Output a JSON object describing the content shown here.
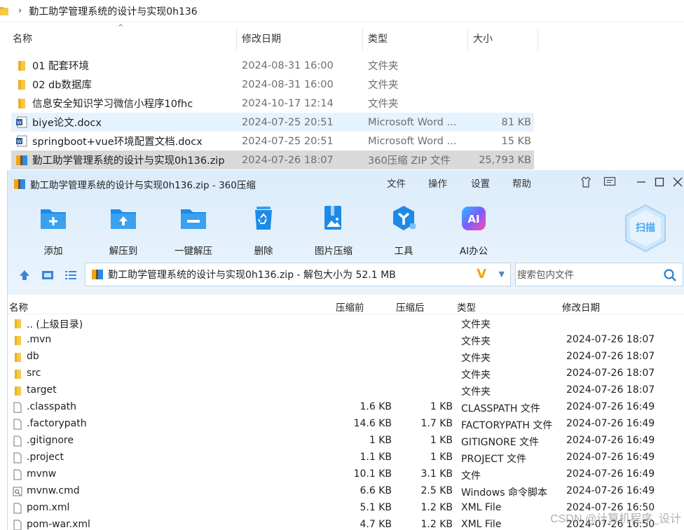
{
  "explorer": {
    "breadcrumb": "勤工助学管理系统的设计与实现0h136",
    "headers": {
      "name": "名称",
      "date": "修改日期",
      "type": "类型",
      "size": "大小"
    },
    "rows": [
      {
        "name": "01 配套环境",
        "date": "2024-08-31 16:00",
        "type": "文件夹",
        "size": "",
        "icon": "folder-icon"
      },
      {
        "name": "02 db数据库",
        "date": "2024-08-31 16:00",
        "type": "文件夹",
        "size": "",
        "icon": "folder-icon"
      },
      {
        "name": "信息安全知识学习微信小程序10fhc",
        "date": "2024-10-17 12:14",
        "type": "文件夹",
        "size": "",
        "icon": "folder-icon"
      },
      {
        "name": "biye论文.docx",
        "date": "2024-07-25 20:51",
        "type": "Microsoft Word ...",
        "size": "81 KB",
        "icon": "word-doc-icon"
      },
      {
        "name": "springboot+vue环境配置文档.docx",
        "date": "2024-07-25 20:51",
        "type": "Microsoft Word ...",
        "size": "15 KB",
        "icon": "word-doc-icon"
      },
      {
        "name": "勤工助学管理系统的设计与实现0h136.zip",
        "date": "2024-07-26 18:07",
        "type": "360压缩 ZIP 文件",
        "size": "25,793 KB",
        "icon": "zip-archive-icon"
      }
    ]
  },
  "zip": {
    "title": "勤工助学管理系统的设计与实现0h136.zip - 360压缩",
    "menu": [
      "文件",
      "操作",
      "设置",
      "帮助"
    ],
    "tools": [
      "添加",
      "解压到",
      "一键解压",
      "删除",
      "图片压缩",
      "工具",
      "AI办公"
    ],
    "scan_label": "扫描",
    "address": "勤工助学管理系统的设计与实现0h136.zip - 解包大小为 52.1 MB",
    "search_placeholder": "搜索包内文件",
    "list_headers": {
      "name": "名称",
      "before": "压缩前",
      "after": "压缩后",
      "type": "类型",
      "date": "修改日期"
    },
    "rows": [
      {
        "name": ".. (上级目录)",
        "before": "",
        "after": "",
        "type": "文件夹",
        "date": "",
        "icon": "folder"
      },
      {
        "name": ".mvn",
        "before": "",
        "after": "",
        "type": "文件夹",
        "date": "2024-07-26 18:07",
        "icon": "folder"
      },
      {
        "name": "db",
        "before": "",
        "after": "",
        "type": "文件夹",
        "date": "2024-07-26 18:07",
        "icon": "folder"
      },
      {
        "name": "src",
        "before": "",
        "after": "",
        "type": "文件夹",
        "date": "2024-07-26 18:07",
        "icon": "folder"
      },
      {
        "name": "target",
        "before": "",
        "after": "",
        "type": "文件夹",
        "date": "2024-07-26 18:07",
        "icon": "folder"
      },
      {
        "name": ".classpath",
        "before": "1.6 KB",
        "after": "1 KB",
        "type": "CLASSPATH 文件",
        "date": "2024-07-26 16:49",
        "icon": "file"
      },
      {
        "name": ".factorypath",
        "before": "14.6 KB",
        "after": "1.7 KB",
        "type": "FACTORYPATH 文件",
        "date": "2024-07-26 16:49",
        "icon": "file"
      },
      {
        "name": ".gitignore",
        "before": "1 KB",
        "after": "1 KB",
        "type": "GITIGNORE 文件",
        "date": "2024-07-26 16:49",
        "icon": "file"
      },
      {
        "name": ".project",
        "before": "1.1 KB",
        "after": "1 KB",
        "type": "PROJECT 文件",
        "date": "2024-07-26 16:49",
        "icon": "file"
      },
      {
        "name": "mvnw",
        "before": "10.1 KB",
        "after": "3.1 KB",
        "type": "文件",
        "date": "2024-07-26 16:49",
        "icon": "file"
      },
      {
        "name": "mvnw.cmd",
        "before": "6.6 KB",
        "after": "2.5 KB",
        "type": "Windows 命令脚本",
        "date": "2024-07-26 16:49",
        "icon": "cmd"
      },
      {
        "name": "pom.xml",
        "before": "5.1 KB",
        "after": "1.2 KB",
        "type": "XML File",
        "date": "2024-07-26 16:50",
        "icon": "file"
      },
      {
        "name": "pom-war.xml",
        "before": "4.7 KB",
        "after": "1.2 KB",
        "type": "XML File",
        "date": "2024-07-26 16:50",
        "icon": "file"
      }
    ]
  },
  "watermark": "CSDN @计算机程序_设计",
  "colors": {
    "accent": "#1a86e8",
    "folder": "#f7c843",
    "zip_header": "#dcecfb"
  }
}
